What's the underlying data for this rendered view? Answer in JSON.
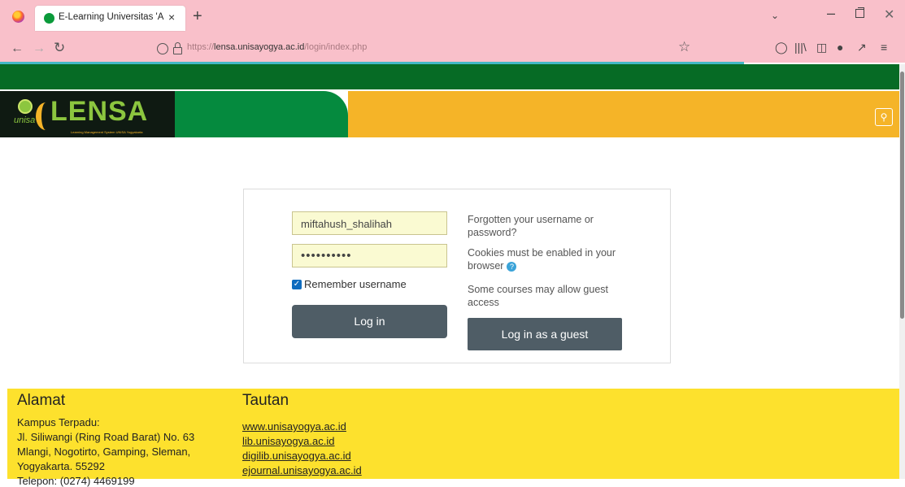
{
  "browser": {
    "tab_title": "E-Learning Universitas 'Aisyiyah",
    "tab_close": "×",
    "new_tab": "+",
    "url_domain": "lensa.unisayogya.ac.id",
    "url_prefix": "https://",
    "url_path": "/login/index.php"
  },
  "header": {
    "logo_unisa": "unisa",
    "logo_text": "LENSA",
    "logo_subtitle": "Learning Management System UNISA Yogyakarta"
  },
  "login": {
    "username_value": "miftahush_shalihah",
    "password_value": "••••••••••",
    "remember_label": "Remember username",
    "login_button": "Log in",
    "forgot_text": "Forgotten your username or password?",
    "cookies_text": "Cookies must be enabled in your browser",
    "guest_note": "Some courses may allow guest access",
    "guest_button": "Log in as a guest"
  },
  "footer": {
    "alamat_title": "Alamat",
    "address": [
      "Kampus Terpadu:",
      "Jl. Siliwangi (Ring Road Barat) No. 63",
      "Mlangi, Nogotirto, Gamping, Sleman,",
      "Yogyakarta. 55292",
      "Telepon: (0274) 4469199"
    ],
    "tautan_title": "Tautan",
    "links": [
      "www.unisayogya.ac.id",
      "lib.unisayogya.ac.id",
      "digilib.unisayogya.ac.id",
      "ejournal.unisayogya.ac.id"
    ]
  },
  "colors": {
    "dark_green": "#066b25",
    "green": "#058a3e",
    "gold": "#f5b428",
    "footer_yellow": "#fde12d",
    "button": "#4f5d66"
  }
}
